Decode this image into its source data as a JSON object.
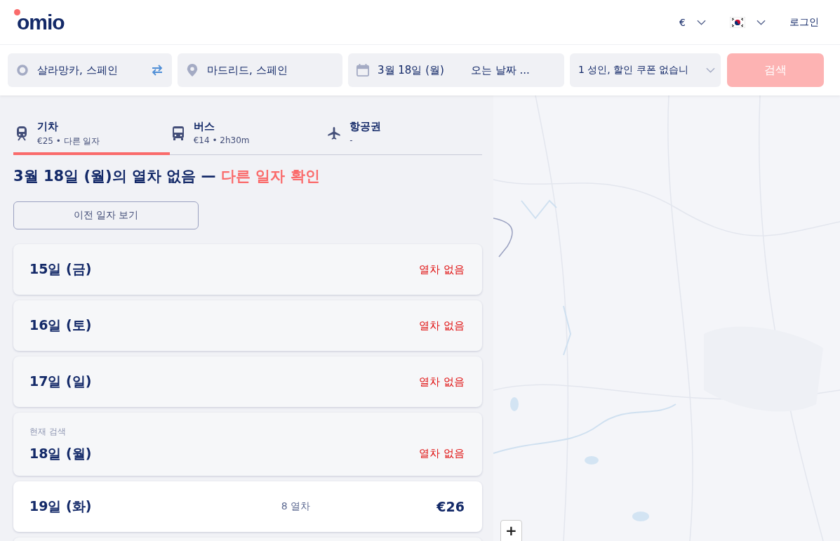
{
  "header": {
    "logo": "omio",
    "currency": "€",
    "login": "로그인"
  },
  "search": {
    "origin": "살라망카, 스페인",
    "destination": "마드리드, 스페인",
    "depart": "3월 18일 (월)",
    "return_placeholder": "오는 날짜 ...",
    "passengers": "1 성인, 할인 쿠폰 없습니",
    "button": "검색",
    "button_disabled": true
  },
  "tabs": [
    {
      "kind": "train",
      "label": "기차",
      "sub": "€25 • 다른 일자",
      "selected": true
    },
    {
      "kind": "bus",
      "label": "버스",
      "sub": "€14 • 2h30m",
      "selected": false
    },
    {
      "kind": "plane",
      "label": "항공권",
      "sub": "-",
      "selected": false
    }
  ],
  "notice": {
    "text": "3월 18일 (월)의 열차 없음 —",
    "link": "다른 일자 확인"
  },
  "earlier_button": "이전 일자 보기",
  "days": [
    {
      "kind": "unavailable",
      "date": "15일 (금)",
      "status": "열차 없음"
    },
    {
      "kind": "unavailable",
      "date": "16일 (토)",
      "status": "열차 없음"
    },
    {
      "kind": "unavailable",
      "date": "17일 (일)",
      "status": "열차 없음"
    },
    {
      "kind": "unavailable",
      "note": "현재 검색",
      "date": "18일 (월)",
      "status": "열차 없음"
    },
    {
      "kind": "available",
      "date": "19일 (화)",
      "count": "8 열차",
      "price": "€26"
    }
  ],
  "map": {
    "zoom_in": "+"
  }
}
